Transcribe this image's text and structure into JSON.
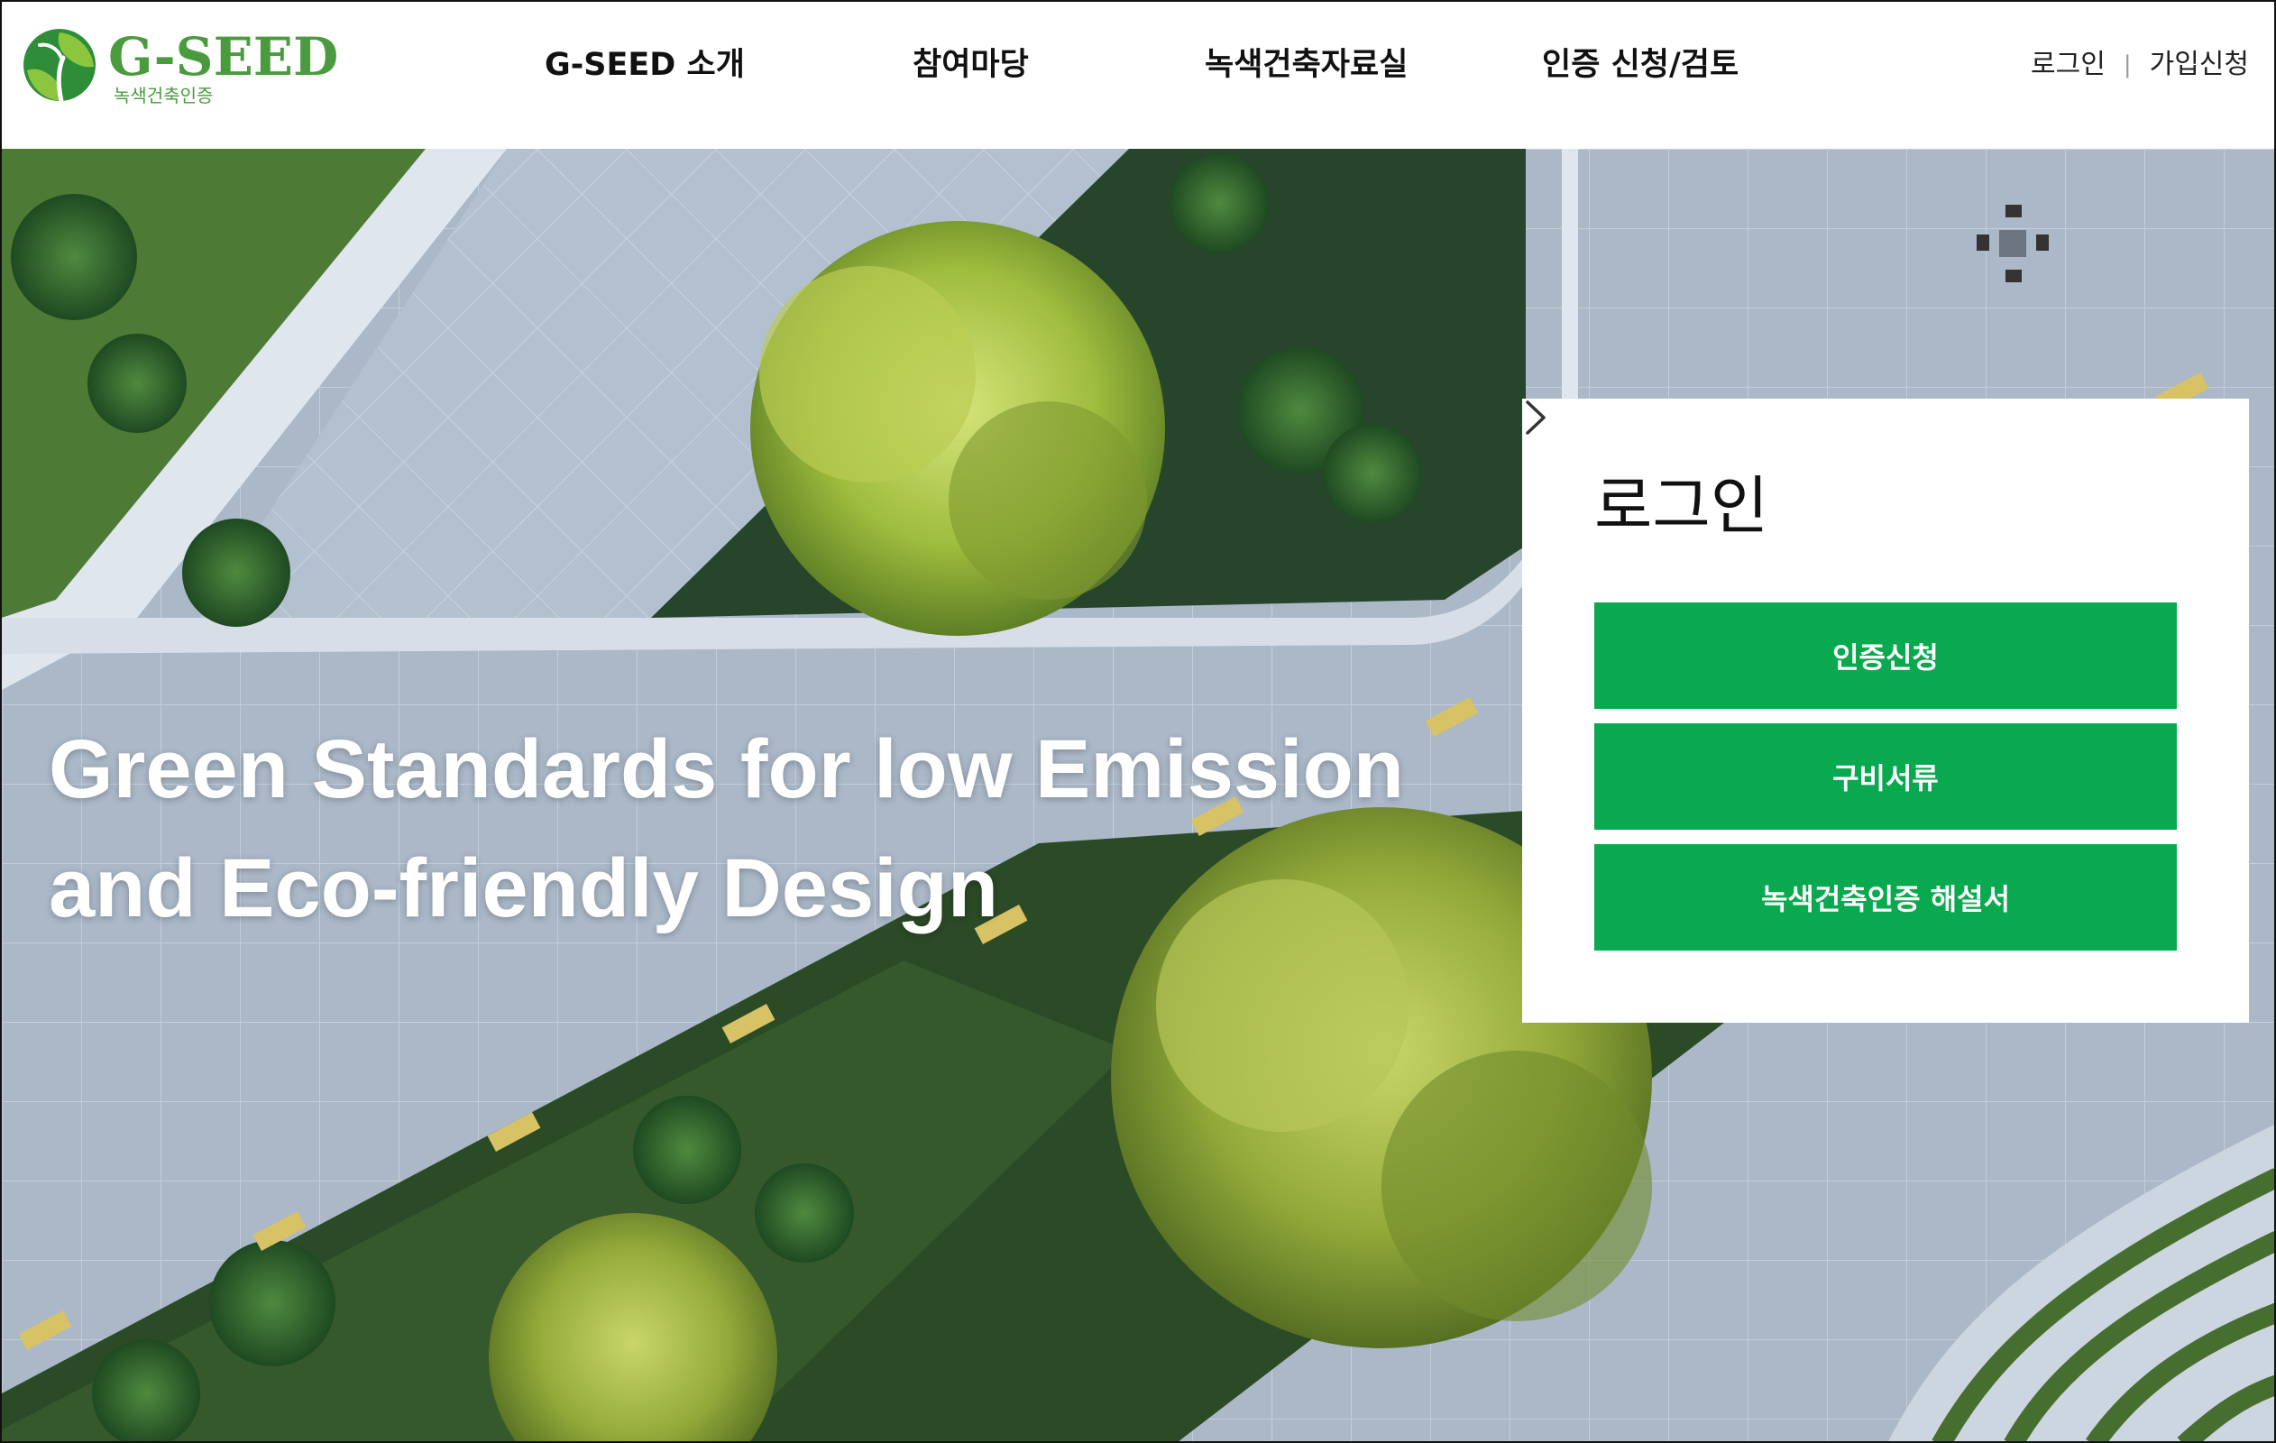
{
  "header": {
    "logo": {
      "title": "G-SEED",
      "subtitle": "녹색건축인증",
      "colors": {
        "brand_green": "#4a9b3e",
        "leaf_light": "#8cc63f",
        "leaf_dark": "#2f8d3a"
      }
    },
    "nav": [
      {
        "label": "G-SEED 소개"
      },
      {
        "label": "참여마당"
      },
      {
        "label": "녹색건축자료실"
      },
      {
        "label": "인증 신청/검토"
      }
    ],
    "util": {
      "login": "로그인",
      "signup": "가입신청"
    }
  },
  "hero": {
    "headline_line1": "Green Standards for low Emission",
    "headline_line2": "and Eco-friendly Design",
    "background": "aerial view of paved plaza with trees and planted strips"
  },
  "login_panel": {
    "title": "로그인",
    "arrow_icon": "chevron-right-icon",
    "buttons": [
      {
        "label": "인증신청"
      },
      {
        "label": "구비서류"
      },
      {
        "label": "녹색건축인증 해설서"
      }
    ],
    "colors": {
      "button_bg": "#09a94f",
      "button_text": "#ffffff"
    }
  }
}
